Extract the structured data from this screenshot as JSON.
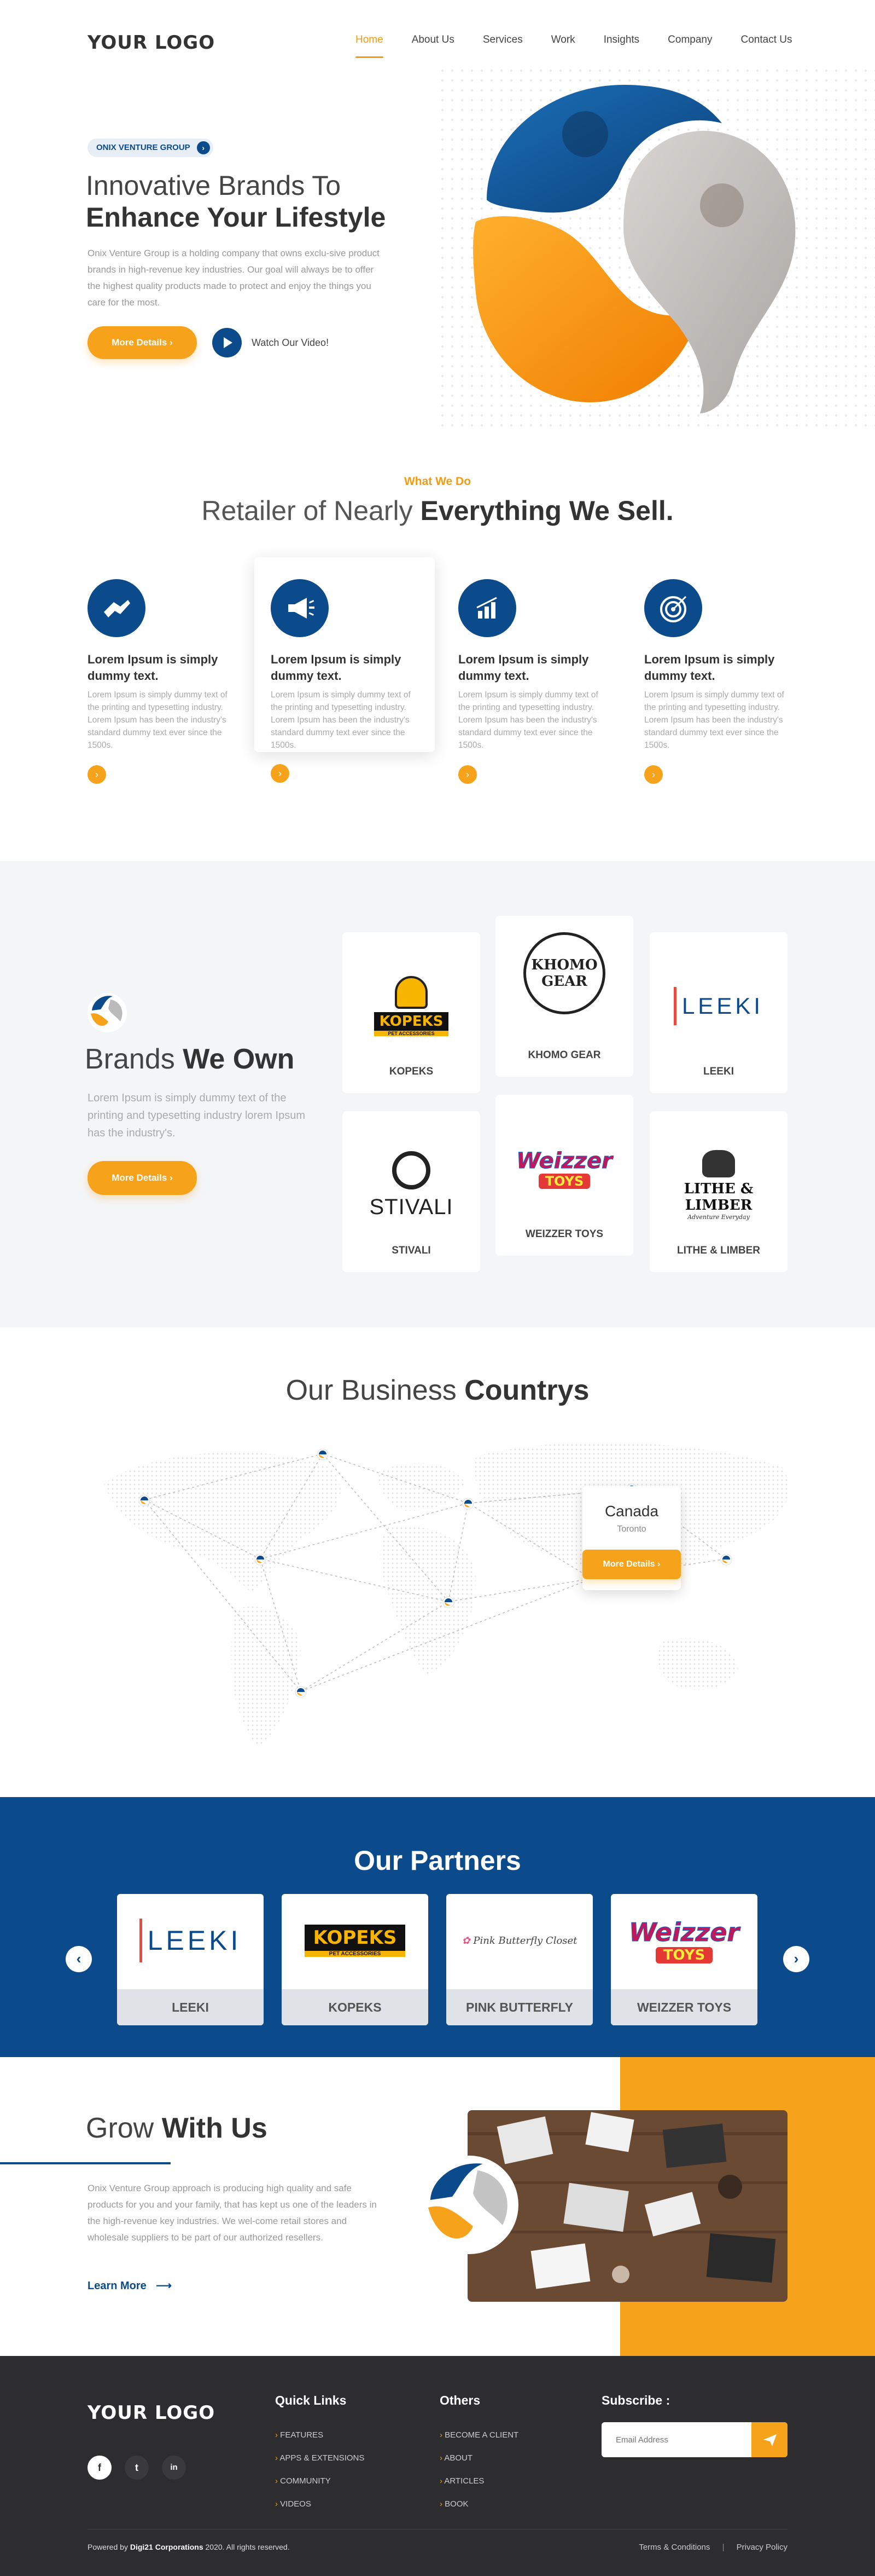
{
  "header": {
    "logo": "YOUR LOGO",
    "nav": [
      "Home",
      "About Us",
      "Services",
      "Work",
      "Insights",
      "Company",
      "Contact Us"
    ],
    "active": "Home"
  },
  "hero": {
    "badge": "ONIX VENTURE GROUP",
    "title_line1": "Innovative Brands To",
    "title_line2": "Enhance Your Lifestyle",
    "paragraph": "Onix Venture Group is a holding company that owns exclu-sive product brands in high-revenue key industries. Our goal will always be to offer the highest quality products made to protect and enjoy the things you care for the most.",
    "button": "More Details",
    "watch": "Watch Our Video!"
  },
  "what_we_do": {
    "subtitle": "What We Do",
    "title_light": "Retailer of Nearly",
    "title_bold": "Everything We Sell.",
    "cards": [
      {
        "icon": "handshake-icon",
        "title": "Lorem Ipsum is simply dummy text.",
        "text": "Lorem Ipsum is simply dummy text of the printing and typesetting industry. Lorem Ipsum has been the industry's standard dummy text ever since the 1500s."
      },
      {
        "icon": "megaphone-icon",
        "title": "Lorem Ipsum is simply dummy text.",
        "text": "Lorem Ipsum is simply dummy text of the printing and typesetting industry. Lorem Ipsum has been the industry's standard dummy text ever since the 1500s."
      },
      {
        "icon": "chart-icon",
        "title": "Lorem Ipsum is simply dummy text.",
        "text": "Lorem Ipsum is simply dummy text of the printing and typesetting industry. Lorem Ipsum has been the industry's standard dummy text ever since the 1500s."
      },
      {
        "icon": "target-icon",
        "title": "Lorem Ipsum is simply dummy text.",
        "text": "Lorem Ipsum is simply dummy text of the printing and typesetting industry. Lorem Ipsum has been the industry's standard dummy text ever since the 1500s."
      }
    ]
  },
  "brands": {
    "title_light": "Brands",
    "title_bold": "We Own",
    "paragraph": "Lorem Ipsum is simply dummy text of the printing and typesetting industry lorem Ipsum has the industry's.",
    "button": "More Details",
    "items": [
      {
        "name": "KOPEKS",
        "logo_text": "KOPEKS",
        "logo_sub": "PET ACCESSORIES"
      },
      {
        "name": "KHOMO GEAR",
        "logo_text": "KHOMO",
        "logo_sub": "GEAR"
      },
      {
        "name": "LEEKI",
        "logo_text": "LEEKI"
      },
      {
        "name": "STIVALI",
        "logo_text": "STIVALI"
      },
      {
        "name": "WEIZZER TOYS",
        "logo_text": "Weizzer",
        "logo_sub": "TOYS"
      },
      {
        "name": "LITHE & LIMBER",
        "logo_text": "LITHE & LIMBER",
        "logo_sub": "Adventure Everyday"
      }
    ]
  },
  "countries": {
    "title_light": "Our Business",
    "title_bold": "Countrys",
    "popup": {
      "country": "Canada",
      "city": "Toronto",
      "button": "More Details"
    }
  },
  "partners": {
    "title": "Our Partners",
    "items": [
      {
        "name": "LEEKI",
        "logo_text": "LEEKI"
      },
      {
        "name": "KOPEKS",
        "logo_text": "KOPEKS",
        "logo_sub": "PET ACCESSORIES"
      },
      {
        "name": "PINK BUTTERFLY",
        "logo_text": "Pink Butterfly Closet"
      },
      {
        "name": "WEIZZER TOYS",
        "logo_text": "Weizzer",
        "logo_sub": "TOYS"
      }
    ]
  },
  "grow": {
    "title_light": "Grow",
    "title_bold": "With Us",
    "paragraph": "Onix Venture Group approach is producing high quality and safe products for you and your family, that has kept us one of the leaders in the high-revenue key industries. We wel-come retail stores and wholesale suppliers to be part of our authorized resellers.",
    "link": "Learn More"
  },
  "footer": {
    "logo": "YOUR LOGO",
    "social": [
      "f",
      "t",
      "in"
    ],
    "quick_links_title": "Quick Links",
    "quick_links": [
      "FEATURES",
      "APPS & EXTENSIONS",
      "COMMUNITY",
      "VIDEOS"
    ],
    "others_title": "Others",
    "others": [
      "BECOME A CLIENT",
      "ABOUT",
      "ARTICLES",
      "BOOK"
    ],
    "subscribe_title": "Subscribe :",
    "email_placeholder": "Email Address",
    "copyright_prefix": "Powered by",
    "copyright_company": "Digi21 Corporations",
    "copyright_suffix": "2020. All rights reserved.",
    "terms": "Terms & Conditions",
    "privacy": "Privacy Policy"
  },
  "colors": {
    "orange": "#f7a21b",
    "blue": "#0b4a8b",
    "dark": "#2d2d2f"
  }
}
